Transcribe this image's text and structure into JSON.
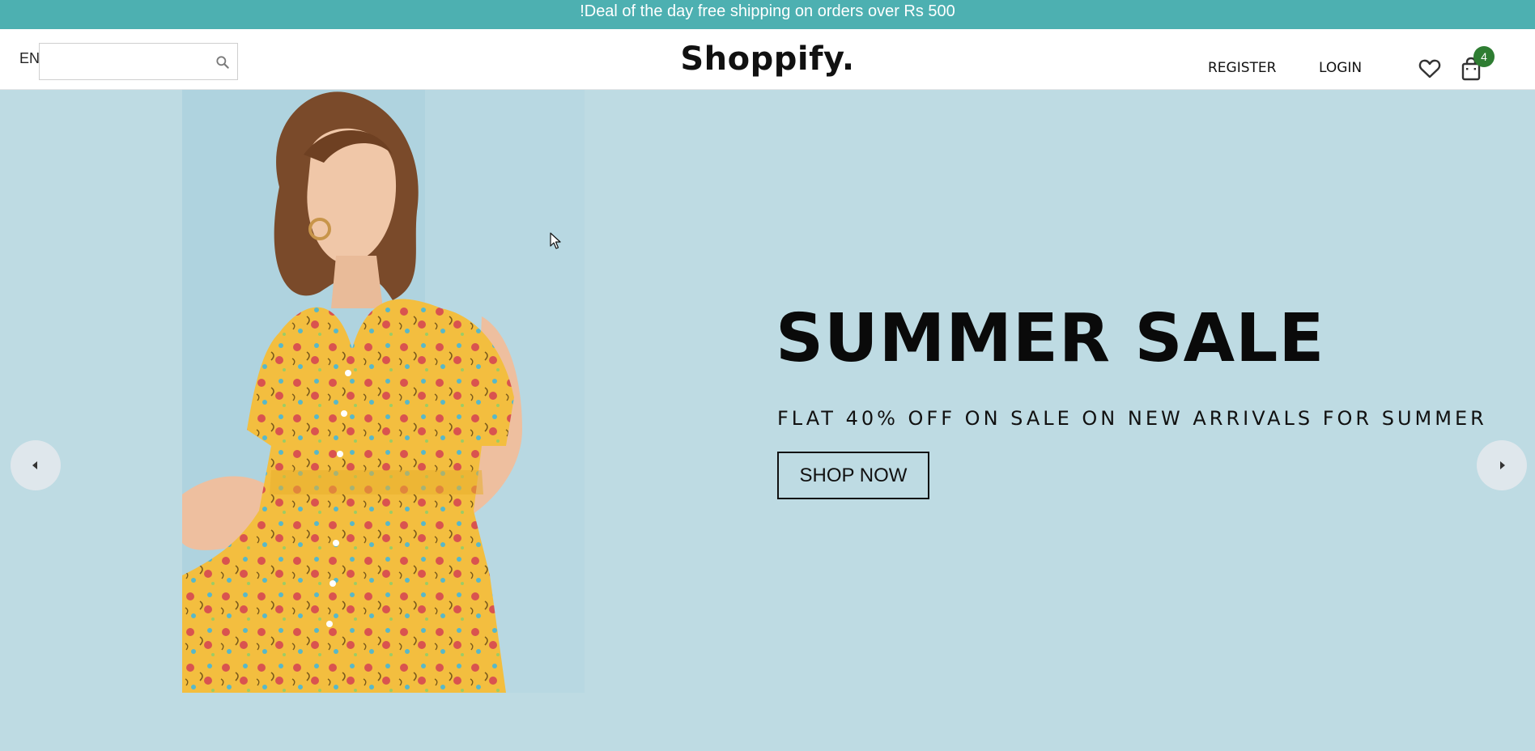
{
  "announcement": "!Deal of the day free shipping on orders over Rs 500",
  "header": {
    "language": "EN",
    "search": {
      "value": "",
      "placeholder": ""
    },
    "logo": "Shoppify.",
    "nav": {
      "register": "REGISTER",
      "login": "LOGIN"
    },
    "cart_count": "4",
    "icons": [
      "search-icon",
      "heart-icon",
      "shopping-bag-icon"
    ]
  },
  "hero": {
    "title": "SUMMER SALE",
    "subtitle": "FLAT 40% OFF ON SALE ON NEW ARRIVALS FOR SUMMER",
    "cta_label": "SHOP NOW",
    "image": "woman-in-yellow-floral-dress",
    "icons": [
      "arrow-left-icon",
      "arrow-right-icon"
    ]
  },
  "colors": {
    "announcement_bg": "#4db0b1",
    "hero_bg": "#bedbe3",
    "badge_bg": "#2e7d32",
    "dress": "#f3be3f"
  }
}
